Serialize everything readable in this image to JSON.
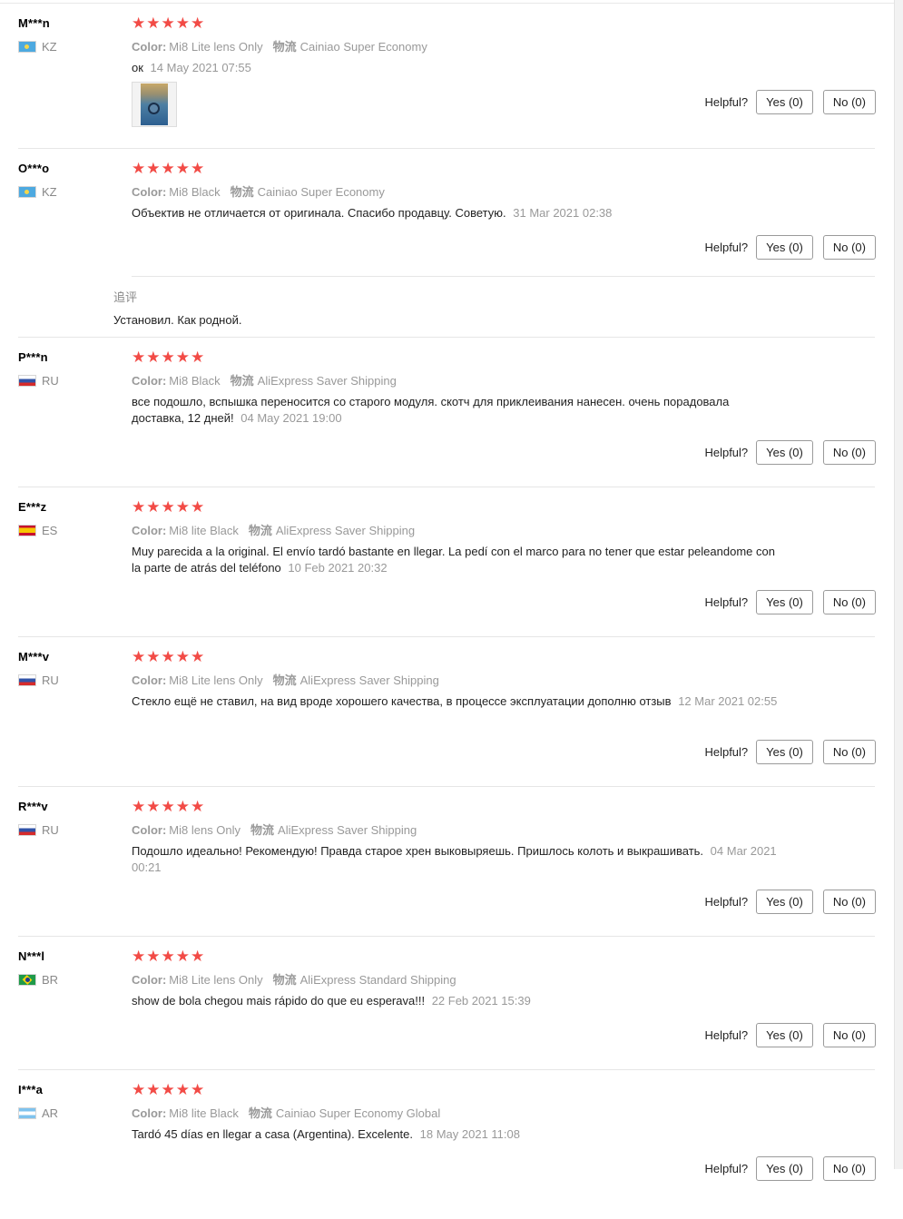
{
  "helpful_label": "Helpful?",
  "star_glyph": "★",
  "colors": {
    "star": "#f24b46",
    "muted": "#999999",
    "border": "#e6e6e6"
  },
  "reviews": [
    {
      "user": "M***n",
      "country": "KZ",
      "flag": "kz",
      "rating": 5,
      "color_label": "Color:",
      "color_value": "Mi8 Lite lens Only",
      "shipping_label": "物流",
      "shipping_value": "Cainiao Super Economy",
      "text": "ок",
      "date": "14 May 2021 07:55",
      "has_image": true,
      "yes": "Yes (0)",
      "no": "No (0)"
    },
    {
      "user": "O***o",
      "country": "KZ",
      "flag": "kz",
      "rating": 5,
      "color_label": "Color:",
      "color_value": "Mi8 Black",
      "shipping_label": "物流",
      "shipping_value": "Cainiao Super Economy",
      "text": "Объектив не отличается от оригинала. Спасибо продавцу. Советую.",
      "date": "31 Mar 2021 02:38",
      "yes": "Yes (0)",
      "no": "No (0)",
      "followup_label": "追评",
      "followup_text": "Установил. Как родной."
    },
    {
      "user": "P***n",
      "country": "RU",
      "flag": "ru",
      "rating": 5,
      "color_label": "Color:",
      "color_value": "Mi8 Black",
      "shipping_label": "物流",
      "shipping_value": "AliExpress Saver Shipping",
      "text": "все подошло, вспышка переносится со старого модуля. скотч для приклеивания нанесен. очень порадовала доставка, 12 дней!",
      "date": "04 May 2021 19:00",
      "yes": "Yes (0)",
      "no": "No (0)"
    },
    {
      "user": "E***z",
      "country": "ES",
      "flag": "es",
      "rating": 5,
      "color_label": "Color:",
      "color_value": "Mi8 lite Black",
      "shipping_label": "物流",
      "shipping_value": "AliExpress Saver Shipping",
      "text": "Muy parecida a la original. El envío tardó bastante en llegar. La pedí con el marco para no tener que estar peleandome con la parte de atrás del teléfono",
      "date": "10 Feb 2021 20:32",
      "yes": "Yes (0)",
      "no": "No (0)"
    },
    {
      "user": "M***v",
      "country": "RU",
      "flag": "ru",
      "rating": 5,
      "color_label": "Color:",
      "color_value": "Mi8 Lite lens Only",
      "shipping_label": "物流",
      "shipping_value": "AliExpress Saver Shipping",
      "text": "Стекло ещё не ставил, на вид вроде хорошего качества, в процессе эксплуатации дополню отзыв",
      "date": "12 Mar 2021 02:55",
      "yes": "Yes (0)",
      "no": "No (0)"
    },
    {
      "user": "R***v",
      "country": "RU",
      "flag": "ru",
      "rating": 5,
      "color_label": "Color:",
      "color_value": "Mi8 lens Only",
      "shipping_label": "物流",
      "shipping_value": "AliExpress Saver Shipping",
      "text": "Подошло идеально! Рекомендую! Правда старое хрен выковыряешь. Пришлось колоть и выкрашивать.",
      "date": "04 Mar 2021 00:21",
      "yes": "Yes (0)",
      "no": "No (0)"
    },
    {
      "user": "N***l",
      "country": "BR",
      "flag": "br",
      "rating": 5,
      "color_label": "Color:",
      "color_value": "Mi8 Lite lens Only",
      "shipping_label": "物流",
      "shipping_value": "AliExpress Standard Shipping",
      "text": "show de bola chegou mais rápido do que eu esperava!!!",
      "date": "22 Feb 2021 15:39",
      "yes": "Yes (0)",
      "no": "No (0)"
    },
    {
      "user": "I***a",
      "country": "AR",
      "flag": "ar",
      "rating": 5,
      "color_label": "Color:",
      "color_value": "Mi8 lite Black",
      "shipping_label": "物流",
      "shipping_value": "Cainiao Super Economy Global",
      "text": "Tardó 45 días en llegar a casa (Argentina). Excelente.",
      "date": "18 May 2021 11:08",
      "yes": "Yes (0)",
      "no": "No (0)"
    }
  ]
}
